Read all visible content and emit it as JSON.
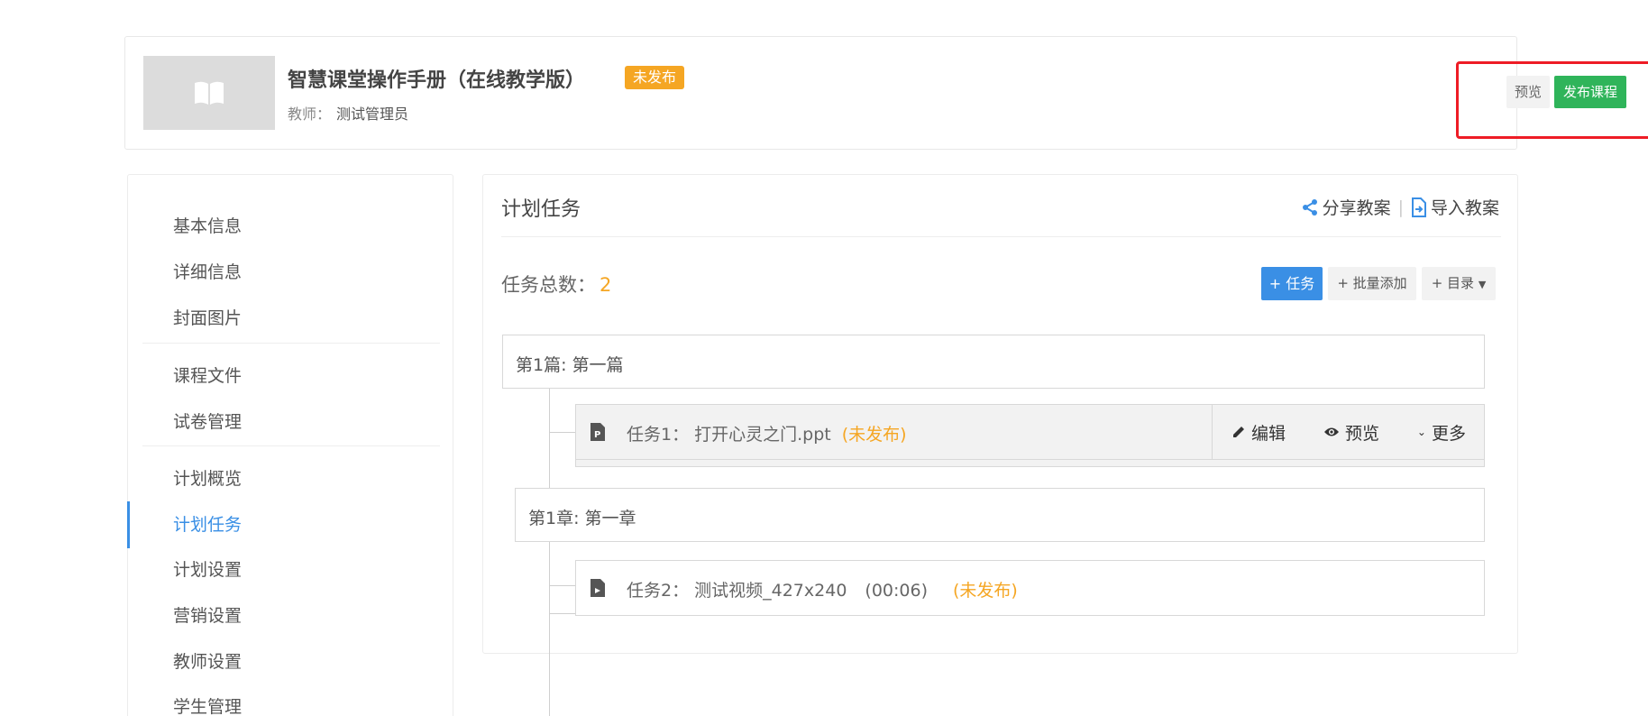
{
  "header": {
    "title": "智慧课堂操作手册（在线教学版）",
    "status": "未发布",
    "teacher_label": "教师：",
    "teacher_name": "测试管理员",
    "preview_label": "预览",
    "publish_label": "发布课程"
  },
  "sidebar": {
    "items": [
      {
        "label": "基本信息"
      },
      {
        "label": "详细信息"
      },
      {
        "label": "封面图片"
      },
      {
        "label": "课程文件"
      },
      {
        "label": "试卷管理"
      },
      {
        "label": "计划概览"
      },
      {
        "label": "计划任务"
      },
      {
        "label": "计划设置"
      },
      {
        "label": "营销设置"
      },
      {
        "label": "教师设置"
      },
      {
        "label": "学生管理"
      }
    ],
    "active_item": "计划任务"
  },
  "main": {
    "title": "计划任务",
    "share_label": "分享教案",
    "import_label": "导入教案",
    "task_count_label": "任务总数：",
    "task_count": "2",
    "add_task_label": "+ 任务",
    "batch_add_label": "+ 批量添加",
    "catalog_label": "+ 目录",
    "part_label": "第1篇: 第一篇",
    "chapter_label": "第1章: 第一章",
    "tasks": [
      {
        "label": "任务1：  打开心灵之门.ppt",
        "duration": "",
        "status": "(未发布)",
        "icon": "ppt-file-icon"
      },
      {
        "label": "任务2：  测试视频_427x240",
        "duration": "(00:06)",
        "status": "(未发布)",
        "icon": "video-file-icon"
      }
    ],
    "task_actions": {
      "edit_label": "编辑",
      "preview_label": "预览",
      "more_label": "更多"
    }
  },
  "colors": {
    "accent_blue": "#3a8fe5",
    "publish_green": "#2fb45a",
    "status_orange": "#f5a623",
    "highlight_red": "#ee1c25"
  }
}
